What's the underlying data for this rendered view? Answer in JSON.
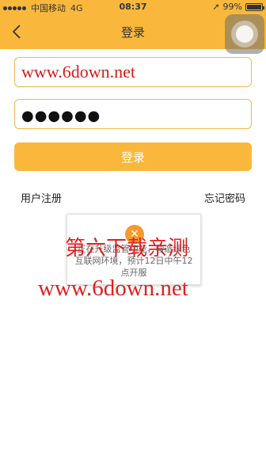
{
  "status_bar": {
    "carrier": "中国移动",
    "network": "4G",
    "time": "08:37",
    "battery": "99%"
  },
  "nav": {
    "title": "登录"
  },
  "form": {
    "username_value": "www.6down.net",
    "password_masked": "●●●●●●",
    "login_label": "登录",
    "register_label": "用户注册",
    "forgot_label": "忘记密码"
  },
  "popup": {
    "message": "正在升级监管功能，营造绿色互联网环境，预计12日中午12点开服"
  },
  "watermark": {
    "text_cn": "第六下载亲测",
    "url": "www.6down.net"
  },
  "colors": {
    "accent": "#f9b83c",
    "watermark": "#e02020",
    "close_button": "#f59a2c"
  }
}
